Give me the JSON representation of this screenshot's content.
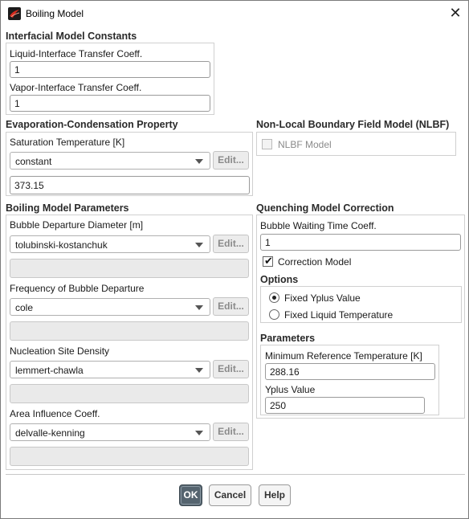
{
  "window": {
    "title": "Boiling Model"
  },
  "interfacial": {
    "title": "Interfacial Model Constants",
    "liquid_label": "Liquid-Interface Transfer Coeff.",
    "liquid_value": "1",
    "vapor_label": "Vapor-Interface Transfer Coeff.",
    "vapor_value": "1"
  },
  "evaporation": {
    "title": "Evaporation-Condensation Property",
    "sat_temp_label": "Saturation Temperature [K]",
    "sat_temp_method": "constant",
    "edit_label": "Edit...",
    "sat_temp_value": "373.15"
  },
  "nlbf": {
    "title": "Non-Local Boundary Field Model (NLBF)",
    "checkbox_label": "NLBF Model",
    "checked": false
  },
  "boiling": {
    "title": "Boiling Model Parameters",
    "edit_label": "Edit...",
    "items": [
      {
        "label": "Bubble Departure Diameter [m]",
        "value": "tolubinski-kostanchuk"
      },
      {
        "label": "Frequency of Bubble Departure",
        "value": "cole"
      },
      {
        "label": "Nucleation Site Density",
        "value": "lemmert-chawla"
      },
      {
        "label": "Area Influence Coeff.",
        "value": "delvalle-kenning"
      }
    ]
  },
  "quenching": {
    "title": "Quenching Model Correction",
    "waiting_label": "Bubble Waiting Time Coeff.",
    "waiting_value": "1",
    "correction_label": "Correction Model",
    "correction_checked": true,
    "options_title": "Options",
    "option_fixed_yplus": "Fixed Yplus Value",
    "option_fixed_liquid": "Fixed Liquid Temperature",
    "selected_option": "Fixed Yplus Value",
    "parameters_title": "Parameters",
    "min_ref_temp_label": "Minimum Reference Temperature [K]",
    "min_ref_temp_value": "288.16",
    "yplus_label": "Yplus Value",
    "yplus_value": "250"
  },
  "buttons": {
    "ok": "OK",
    "cancel": "Cancel",
    "help": "Help"
  },
  "colors": {
    "primary_button": "#55646f",
    "icon_red": "#b1231b"
  }
}
